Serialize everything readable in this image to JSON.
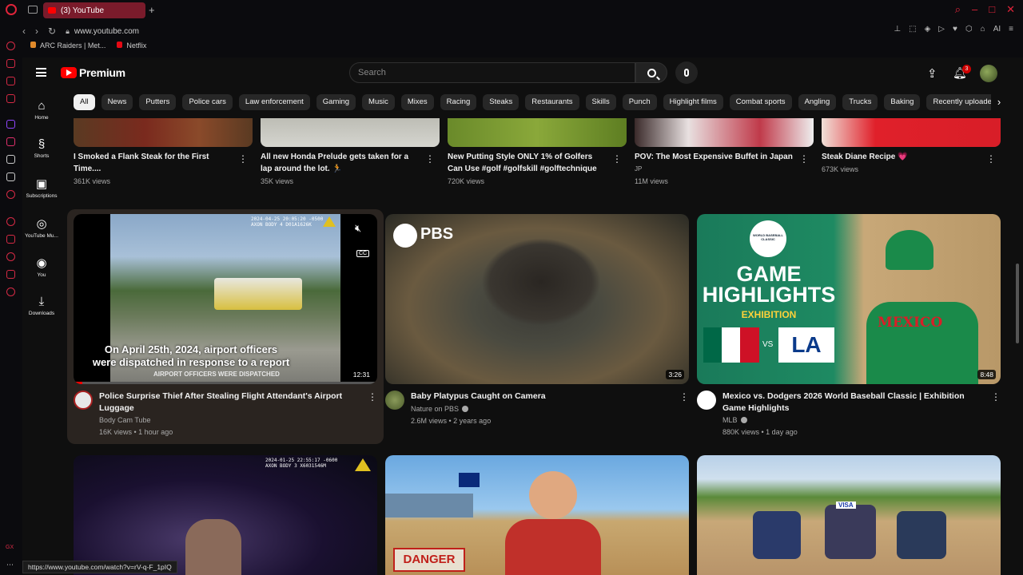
{
  "browser": {
    "tab_title": "(3) YouTube",
    "url": "www.youtube.com",
    "bookmarks": [
      "ARC Raiders | Met...",
      "Netflix"
    ],
    "status_url": "https://www.youtube.com/watch?v=rV-q-F_1pIQ",
    "gx_label": "GX",
    "ai_label": "AI"
  },
  "header": {
    "brand": "Premium",
    "search_placeholder": "Search",
    "notifications": "3"
  },
  "sidebar": {
    "items": [
      {
        "label": "Home",
        "icon": "home-icon",
        "glyph": "⌂"
      },
      {
        "label": "Shorts",
        "icon": "shorts-icon",
        "glyph": "§"
      },
      {
        "label": "Subscriptions",
        "icon": "subscriptions-icon",
        "glyph": "▣"
      },
      {
        "label": "YouTube Mu...",
        "icon": "music-icon",
        "glyph": "◎"
      },
      {
        "label": "You",
        "icon": "you-icon",
        "glyph": "◉"
      },
      {
        "label": "Downloads",
        "icon": "download-icon",
        "glyph": "⤓"
      }
    ]
  },
  "chips": [
    "All",
    "News",
    "Putters",
    "Police cars",
    "Law enforcement",
    "Gaming",
    "Music",
    "Mixes",
    "Racing",
    "Steaks",
    "Restaurants",
    "Skills",
    "Punch",
    "Highlight films",
    "Combat sports",
    "Angling",
    "Trucks",
    "Baking",
    "Recently uploaded"
  ],
  "row1": [
    {
      "title": "I Smoked a Flank Steak for the First Time....",
      "channel": "",
      "views": "361K views"
    },
    {
      "title": "All new Honda Prelude gets taken for a lap around the lot. 🏃",
      "channel": "",
      "views": "35K views"
    },
    {
      "title": "New Putting Style ONLY 1% of Golfers Can Use #golf #golfskill #golftechnique",
      "channel": "",
      "views": "720K views"
    },
    {
      "title": "POV: The Most Expensive Buffet in Japan",
      "channel": "JP",
      "views": "11M views"
    },
    {
      "title": "Steak Diane Recipe 💗",
      "channel": "",
      "views": "673K views"
    }
  ],
  "row2": [
    {
      "title": "Police Surprise Thief After Stealing Flight Attendant's Airport Luggage",
      "channel": "Body Cam Tube",
      "meta": "16K views • 1 hour ago",
      "duration": "12:31",
      "overlay_timestamp": "2024-04-25 20:05:20 -0500",
      "overlay_device": "AXON BODY 4 D01A1626K",
      "caption_line1": "On April 25th, 2024, airport officers",
      "caption_line2": "were dispatched in response to a report",
      "caption_line3": "AIRPORT OFFICERS WERE DISPATCHED",
      "cc_label": "CC"
    },
    {
      "title": "Baby Platypus Caught on Camera",
      "channel": "Nature on PBS",
      "meta": "2.6M views • 2 years ago",
      "duration": "3:26",
      "logo_text": "PBS"
    },
    {
      "title": "Mexico vs. Dodgers 2026 World Baseball Classic | Exhibition Game Highlights",
      "channel": "MLB",
      "meta": "880K views • 1 day ago",
      "duration": "8:48",
      "thumb_line1": "GAME",
      "thumb_line2": "HIGHLIGHTS",
      "thumb_line3": "EXHIBITION",
      "vs": "VS",
      "la": "LA",
      "jersey": "MEXICO",
      "wbc_line1": "WORLD BASEBALL",
      "wbc_line2": "CLASSIC"
    }
  ],
  "row3": [
    {
      "overlay_timestamp": "2024-01-25 22:55:17 -0600",
      "overlay_device": "AXON BODY 3 X6031546M"
    },
    {
      "danger_text": "DANGER"
    },
    {
      "visa_text": "VISA"
    }
  ],
  "colors": {
    "background": "#0f0f0f",
    "chip": "#272727",
    "accent_red": "#ff0000",
    "opera_red": "#e0243a",
    "hover_card": "#2a2420"
  }
}
